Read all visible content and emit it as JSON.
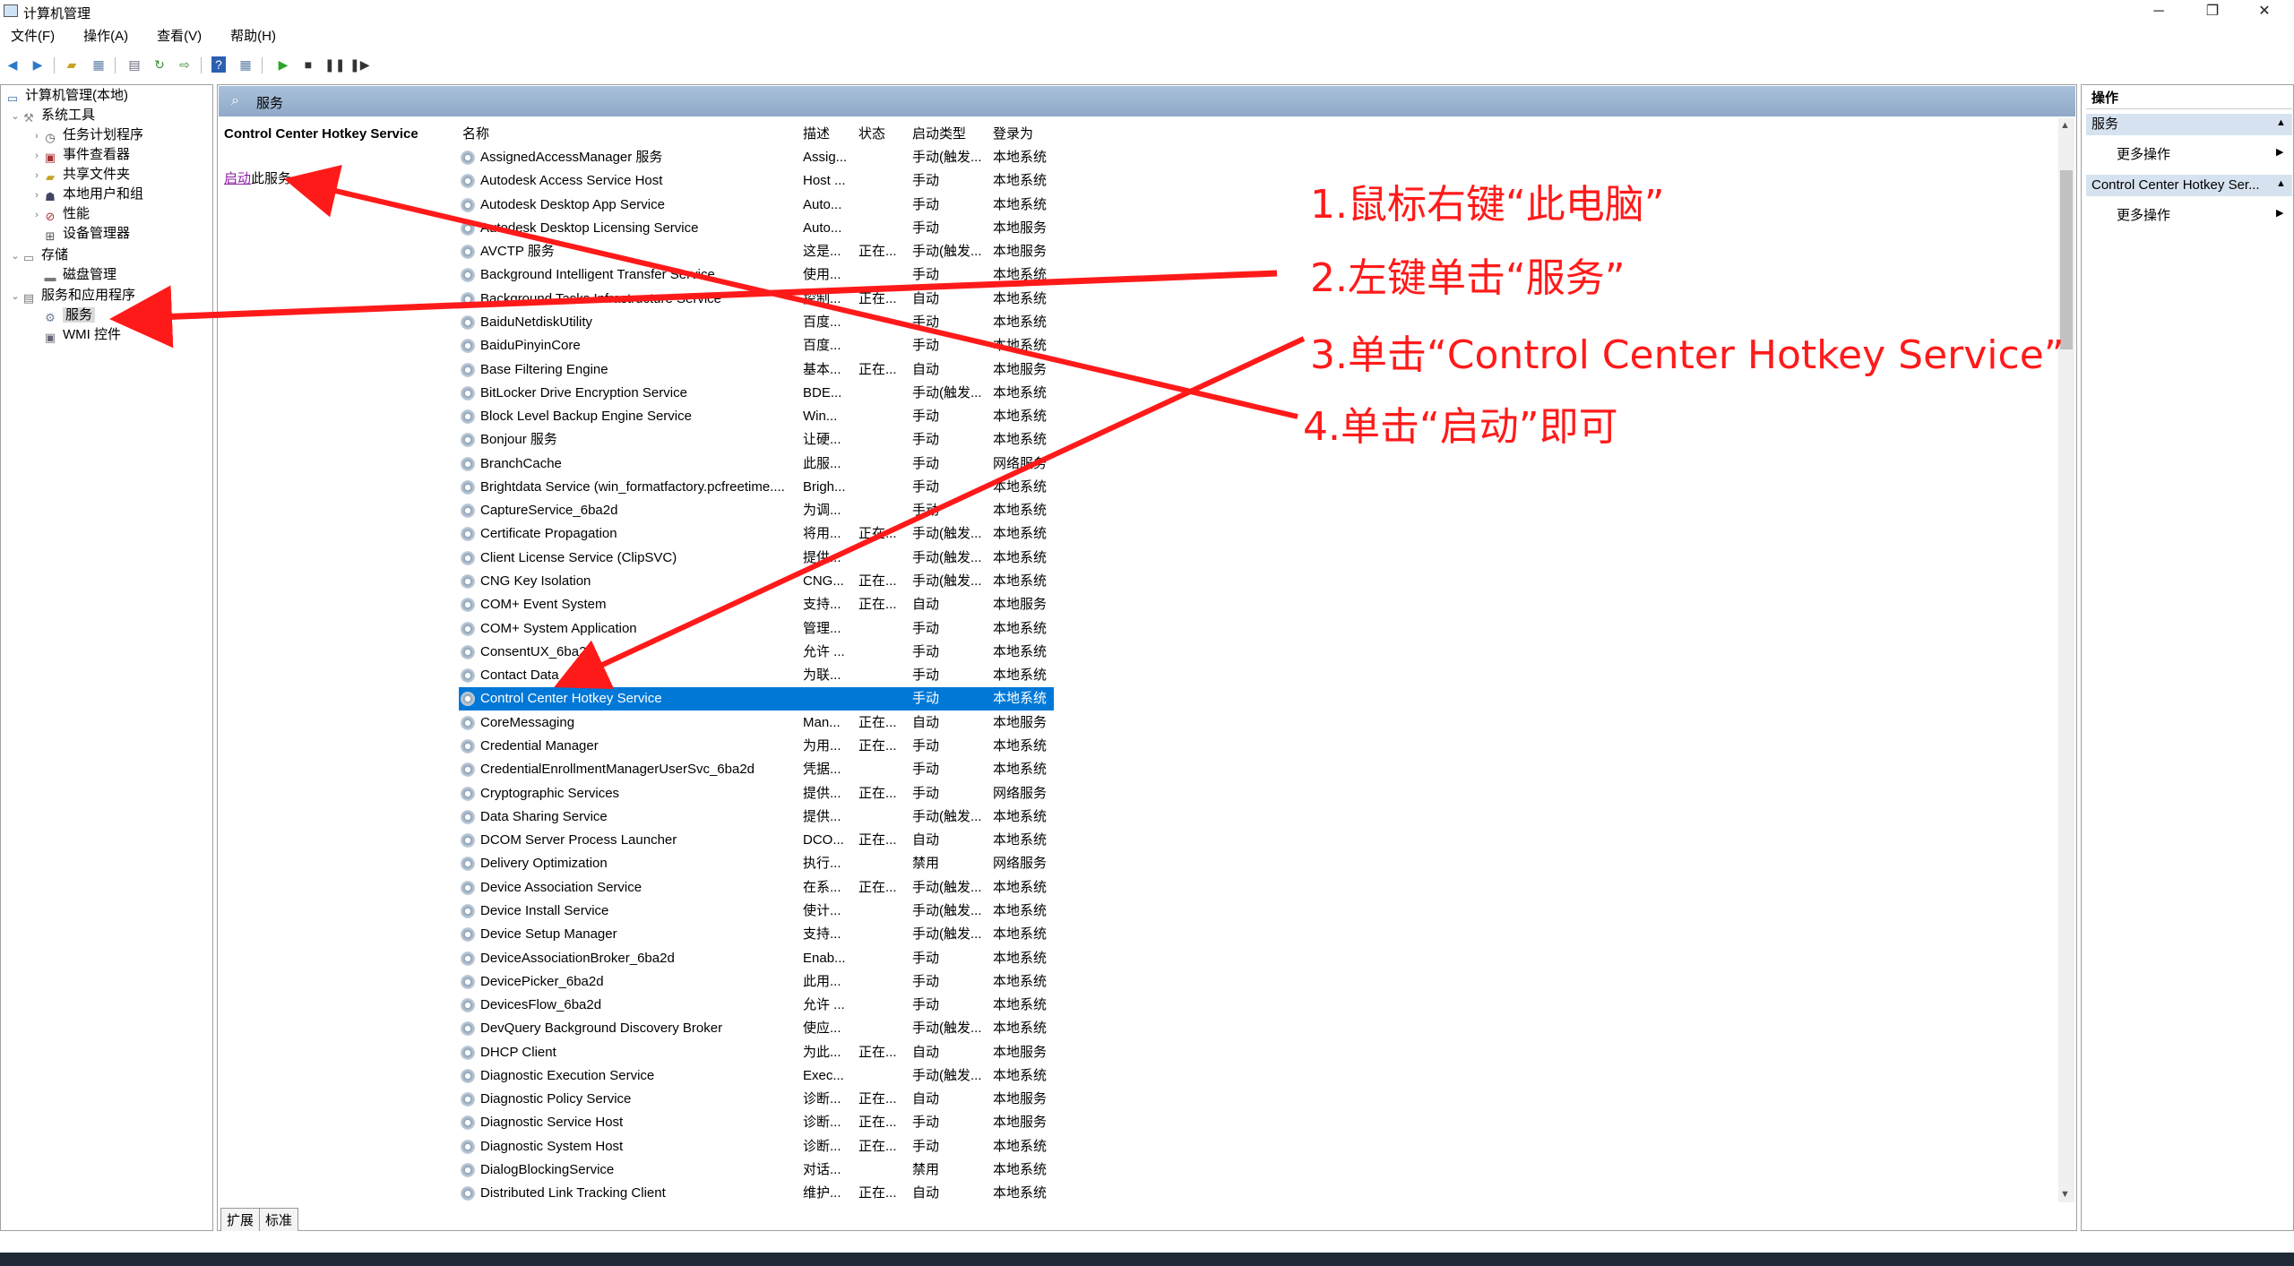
{
  "window": {
    "title": "计算机管理",
    "controls": {
      "minimize": "─",
      "restore": "❐",
      "close": "✕"
    }
  },
  "menu": [
    "文件(F)",
    "操作(A)",
    "查看(V)",
    "帮助(H)"
  ],
  "toolbar_icons": [
    "back-arrow-icon",
    "forward-arrow-icon",
    "up-folder-icon",
    "show-hide-tree-icon",
    "properties-icon",
    "refresh-icon",
    "export-list-icon",
    "help-icon",
    "console-view-icon",
    "play-icon",
    "stop-icon",
    "pause-icon",
    "resume-icon"
  ],
  "tree": {
    "root": "计算机管理(本地)",
    "items": [
      {
        "label": "系统工具",
        "icon": "tools-icon"
      },
      {
        "label": "任务计划程序",
        "icon": "clock-icon"
      },
      {
        "label": "事件查看器",
        "icon": "event-viewer-icon"
      },
      {
        "label": "共享文件夹",
        "icon": "shared-folder-icon"
      },
      {
        "label": "本地用户和组",
        "icon": "users-icon"
      },
      {
        "label": "性能",
        "icon": "performance-icon"
      },
      {
        "label": "设备管理器",
        "icon": "device-manager-icon"
      },
      {
        "label": "存储",
        "icon": "storage-icon"
      },
      {
        "label": "磁盘管理",
        "icon": "disk-icon"
      },
      {
        "label": "服务和应用程序",
        "icon": "services-apps-icon"
      },
      {
        "label": "服务",
        "icon": "services-icon"
      },
      {
        "label": "WMI 控件",
        "icon": "wmi-icon"
      }
    ]
  },
  "center": {
    "header_title": "服务",
    "selected_service_title": "Control Center Hotkey Service",
    "start_link": "启动",
    "start_suffix": "此服务",
    "columns": [
      "名称",
      "描述",
      "状态",
      "启动类型",
      "登录为"
    ],
    "rows": [
      [
        "AssignedAccessManager 服务",
        "Assig...",
        "",
        "手动(触发...",
        "本地系统"
      ],
      [
        "Autodesk Access Service Host",
        "Host ...",
        "",
        "手动",
        "本地系统"
      ],
      [
        "Autodesk Desktop App Service",
        "Auto...",
        "",
        "手动",
        "本地系统"
      ],
      [
        "Autodesk Desktop Licensing Service",
        "Auto...",
        "",
        "手动",
        "本地服务"
      ],
      [
        "AVCTP 服务",
        "这是...",
        "正在...",
        "手动(触发...",
        "本地服务"
      ],
      [
        "Background Intelligent Transfer Service",
        "使用...",
        "",
        "手动",
        "本地系统"
      ],
      [
        "Background Tasks Infrastructure Service",
        "控制...",
        "正在...",
        "自动",
        "本地系统"
      ],
      [
        "BaiduNetdiskUtility",
        "百度...",
        "",
        "手动",
        "本地系统"
      ],
      [
        "BaiduPinyinCore",
        "百度...",
        "",
        "手动",
        "本地系统"
      ],
      [
        "Base Filtering Engine",
        "基本...",
        "正在...",
        "自动",
        "本地服务"
      ],
      [
        "BitLocker Drive Encryption Service",
        "BDE...",
        "",
        "手动(触发...",
        "本地系统"
      ],
      [
        "Block Level Backup Engine Service",
        "Win...",
        "",
        "手动",
        "本地系统"
      ],
      [
        "Bonjour 服务",
        "让硬...",
        "",
        "手动",
        "本地系统"
      ],
      [
        "BranchCache",
        "此服...",
        "",
        "手动",
        "网络服务"
      ],
      [
        "Brightdata Service (win_formatfactory.pcfreetime....",
        "Brigh...",
        "",
        "手动",
        "本地系统"
      ],
      [
        "CaptureService_6ba2d",
        "为调...",
        "",
        "手动",
        "本地系统"
      ],
      [
        "Certificate Propagation",
        "将用...",
        "正在...",
        "手动(触发...",
        "本地系统"
      ],
      [
        "Client License Service (ClipSVC)",
        "提供...",
        "",
        "手动(触发...",
        "本地系统"
      ],
      [
        "CNG Key Isolation",
        "CNG...",
        "正在...",
        "手动(触发...",
        "本地系统"
      ],
      [
        "COM+ Event System",
        "支持...",
        "正在...",
        "自动",
        "本地服务"
      ],
      [
        "COM+ System Application",
        "管理...",
        "",
        "手动",
        "本地系统"
      ],
      [
        "ConsentUX_6ba2d",
        "允许 ...",
        "",
        "手动",
        "本地系统"
      ],
      [
        "Contact Data_6ba2d",
        "为联...",
        "",
        "手动",
        "本地系统"
      ],
      [
        "Control Center Hotkey Service",
        "",
        "",
        "手动",
        "本地系统"
      ],
      [
        "CoreMessaging",
        "Man...",
        "正在...",
        "自动",
        "本地服务"
      ],
      [
        "Credential Manager",
        "为用...",
        "正在...",
        "手动",
        "本地系统"
      ],
      [
        "CredentialEnrollmentManagerUserSvc_6ba2d",
        "凭据...",
        "",
        "手动",
        "本地系统"
      ],
      [
        "Cryptographic Services",
        "提供...",
        "正在...",
        "手动",
        "网络服务"
      ],
      [
        "Data Sharing Service",
        "提供...",
        "",
        "手动(触发...",
        "本地系统"
      ],
      [
        "DCOM Server Process Launcher",
        "DCO...",
        "正在...",
        "自动",
        "本地系统"
      ],
      [
        "Delivery Optimization",
        "执行...",
        "",
        "禁用",
        "网络服务"
      ],
      [
        "Device Association Service",
        "在系...",
        "正在...",
        "手动(触发...",
        "本地系统"
      ],
      [
        "Device Install Service",
        "使计...",
        "",
        "手动(触发...",
        "本地系统"
      ],
      [
        "Device Setup Manager",
        "支持...",
        "",
        "手动(触发...",
        "本地系统"
      ],
      [
        "DeviceAssociationBroker_6ba2d",
        "Enab...",
        "",
        "手动",
        "本地系统"
      ],
      [
        "DevicePicker_6ba2d",
        "此用...",
        "",
        "手动",
        "本地系统"
      ],
      [
        "DevicesFlow_6ba2d",
        "允许 ...",
        "",
        "手动",
        "本地系统"
      ],
      [
        "DevQuery Background Discovery Broker",
        "使应...",
        "",
        "手动(触发...",
        "本地系统"
      ],
      [
        "DHCP Client",
        "为此...",
        "正在...",
        "自动",
        "本地服务"
      ],
      [
        "Diagnostic Execution Service",
        "Exec...",
        "",
        "手动(触发...",
        "本地系统"
      ],
      [
        "Diagnostic Policy Service",
        "诊断...",
        "正在...",
        "自动",
        "本地服务"
      ],
      [
        "Diagnostic Service Host",
        "诊断...",
        "正在...",
        "手动",
        "本地服务"
      ],
      [
        "Diagnostic System Host",
        "诊断...",
        "正在...",
        "手动",
        "本地系统"
      ],
      [
        "DialogBlockingService",
        "对话...",
        "",
        "禁用",
        "本地系统"
      ],
      [
        "Distributed Link Tracking Client",
        "维护...",
        "正在...",
        "自动",
        "本地系统"
      ]
    ],
    "selected_row": 23,
    "tabs": [
      "扩展",
      "标准"
    ]
  },
  "actions": {
    "title": "操作",
    "section1": "服务",
    "section1_item": "更多操作",
    "section2": "Control Center Hotkey Ser...",
    "section2_item": "更多操作"
  },
  "annotations": [
    "1.鼠标右键“此电脑”",
    "2.左键单击“服务”",
    "3.单击“Control Center Hotkey Service”",
    "4.单击“启动”即可"
  ],
  "colors": {
    "annotation": "#ff1a1a",
    "selection": "#0078d7",
    "header_bar": "#9bb3d0"
  }
}
